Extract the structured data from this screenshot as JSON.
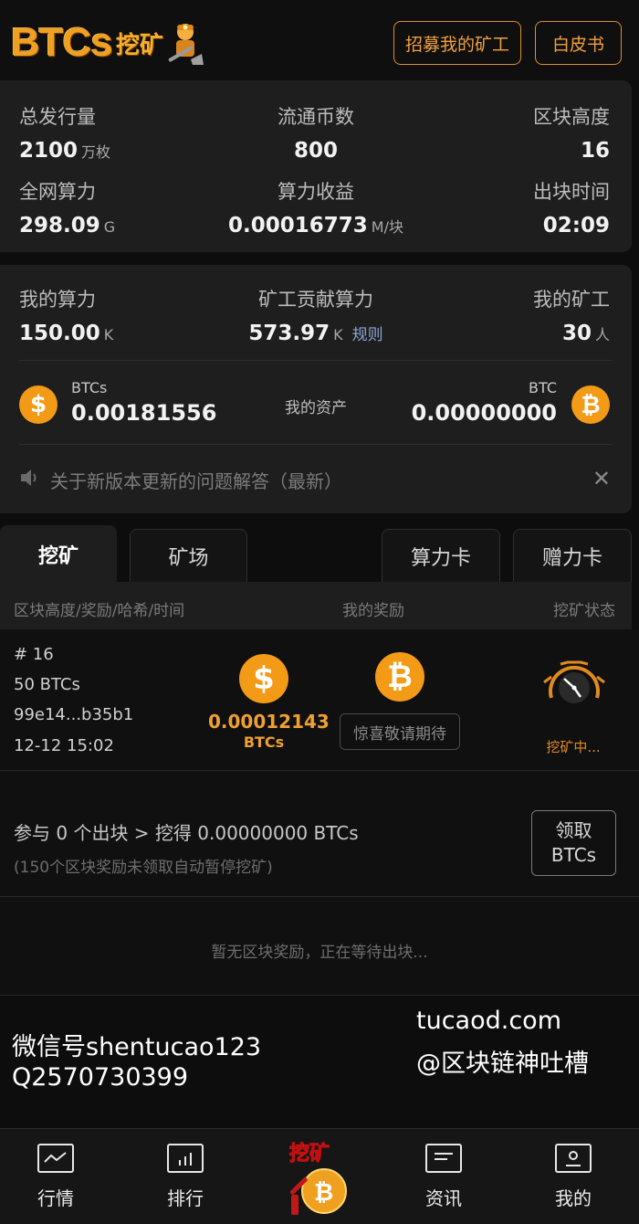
{
  "header": {
    "logo_text": "BTCs",
    "logo_cn": "挖矿",
    "recruit_label": "招募我的矿工",
    "whitepaper_label": "白皮书"
  },
  "stats": {
    "total_supply": {
      "label": "总发行量",
      "value": "2100",
      "unit": "万枚"
    },
    "circulating": {
      "label": "流通币数",
      "value": "800"
    },
    "block_height": {
      "label": "区块高度",
      "value": "16"
    },
    "network_hashrate": {
      "label": "全网算力",
      "value": "298.09",
      "unit": "G"
    },
    "hash_income": {
      "label": "算力收益",
      "value": "0.00016773",
      "unit": "M/块"
    },
    "block_time": {
      "label": "出块时间",
      "value": "02:09"
    }
  },
  "mine": {
    "my_hashrate": {
      "label": "我的算力",
      "value": "150.00",
      "unit": "K"
    },
    "miner_hashrate": {
      "label": "矿工贡献算力",
      "value": "573.97",
      "unit": "K",
      "link": "规则"
    },
    "my_miners": {
      "label": "我的矿工",
      "value": "30",
      "unit": "人"
    }
  },
  "assets": {
    "left_coin_icon": "dollar-coin-icon",
    "left_name": "BTCs",
    "left_value": "0.00181556",
    "middle_label": "我的资产",
    "right_name": "BTC",
    "right_value": "0.00000000",
    "right_coin_icon": "bitcoin-coin-icon"
  },
  "notice": {
    "text": "关于新版本更新的问题解答（最新）",
    "close": "✕"
  },
  "tabs": [
    {
      "label": "挖矿",
      "active": true
    },
    {
      "label": "矿场"
    },
    {
      "label": "算力卡"
    },
    {
      "label": "赠力卡"
    }
  ],
  "list_header": {
    "col1": "区块高度/奖励/哈希/时间",
    "col2": "我的奖励",
    "col3": "挖矿状态"
  },
  "block": {
    "height": "# 16",
    "reward": "50 BTCs",
    "hash": "99e14...b35b1",
    "time": "12-12 15:02",
    "my_reward_value": "0.00012143",
    "my_reward_unit": "BTCs",
    "surprise_label": "惊喜敬请期待",
    "status": "挖矿中..."
  },
  "claim": {
    "main_text": "参与 0 个出块 > 挖得 0.00000000 BTCs",
    "sub_text": "(150个区块奖励未领取自动暂停挖矿)",
    "button_line1": "领取",
    "button_line2": "BTCs"
  },
  "empty": {
    "text": "暂无区块奖励，正在等待出块..."
  },
  "watermark": {
    "wechat": "微信号shentucao123",
    "qq": "Q2570730399",
    "site": "tucaod.com",
    "handle": "@区块链神吐槽"
  },
  "nav": [
    {
      "label": "行情",
      "icon": "chart-line-icon"
    },
    {
      "label": "排行",
      "icon": "bar-chart-icon"
    },
    {
      "label": "挖矿",
      "icon": "mining-coin-icon"
    },
    {
      "label": "资讯",
      "icon": "news-icon"
    },
    {
      "label": "我的",
      "icon": "profile-icon"
    }
  ],
  "colors": {
    "accent": "#f0a030",
    "background": "#0d0d0d",
    "card": "#1e1e1e"
  }
}
